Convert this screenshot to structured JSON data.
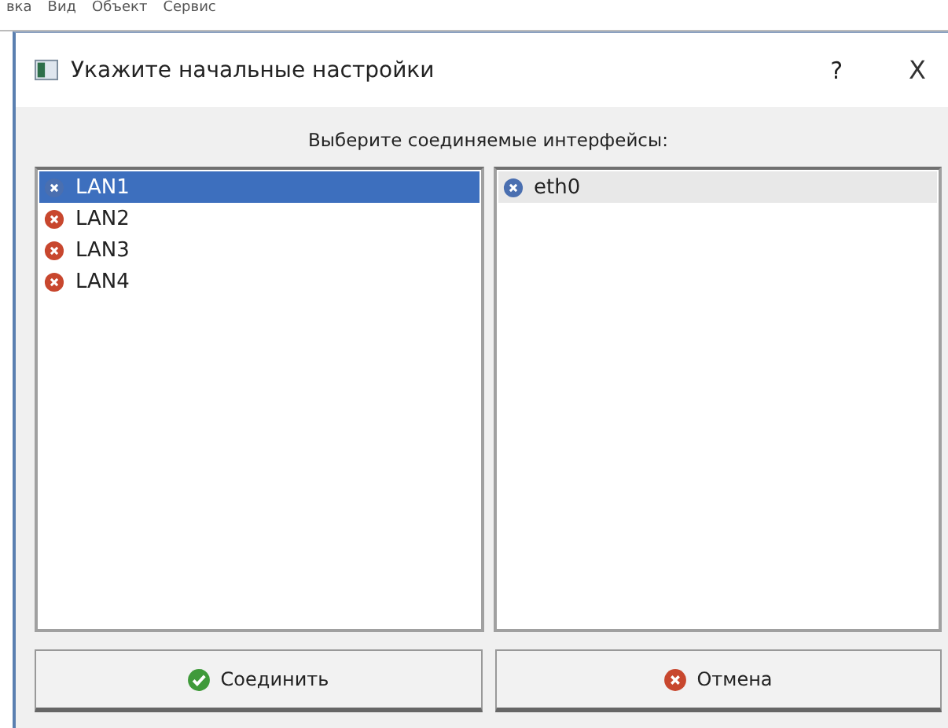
{
  "background_menu": [
    "вка",
    "Вид",
    "Объект",
    "Сервис"
  ],
  "window": {
    "title": "Укажите начальные настройки",
    "help": "?",
    "close": "X"
  },
  "prompt": "Выберите соединяемые интерфейсы:",
  "lists": [
    {
      "focused": true,
      "items": [
        {
          "label": "LAN1",
          "selected": true,
          "color": "#4a6fb0"
        },
        {
          "label": "LAN2",
          "selected": false,
          "color": "#c8472e"
        },
        {
          "label": "LAN3",
          "selected": false,
          "color": "#c8472e"
        },
        {
          "label": "LAN4",
          "selected": false,
          "color": "#c8472e"
        }
      ]
    },
    {
      "focused": false,
      "items": [
        {
          "label": "eth0",
          "selected": true,
          "color": "#4a6fb0"
        }
      ]
    }
  ],
  "buttons": [
    {
      "label": "Соединить",
      "kind": "ok"
    },
    {
      "label": "Отмена",
      "kind": "cancel"
    }
  ]
}
